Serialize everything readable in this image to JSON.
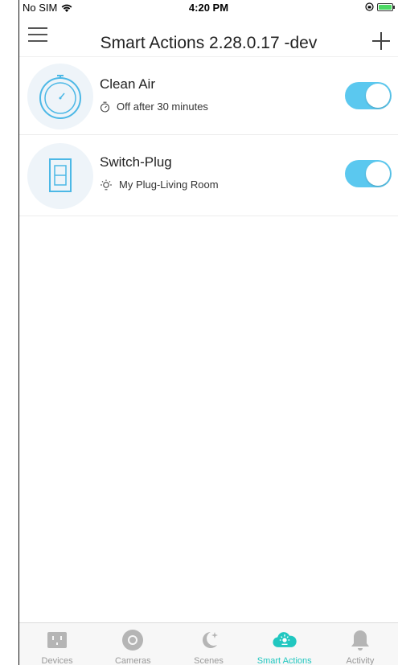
{
  "status_bar": {
    "carrier": "No SIM",
    "time": "4:20 PM"
  },
  "nav": {
    "title": "Smart Actions 2.28.0.17 -dev",
    "menu_icon": "hamburger-menu-icon",
    "add_icon": "plus-icon"
  },
  "actions": [
    {
      "title": "Clean Air",
      "subtitle": "Off after 30 minutes",
      "icon": "timer-icon",
      "sub_icon": "stopwatch-icon",
      "enabled": true
    },
    {
      "title": "Switch-Plug",
      "subtitle": "My Plug-Living Room",
      "icon": "light-switch-icon",
      "sub_icon": "bulb-icon",
      "enabled": true
    }
  ],
  "tabs": [
    {
      "label": "Devices",
      "icon": "outlet-icon",
      "active": false
    },
    {
      "label": "Cameras",
      "icon": "camera-icon",
      "active": false
    },
    {
      "label": "Scenes",
      "icon": "moon-icon",
      "active": false
    },
    {
      "label": "Smart Actions",
      "icon": "cloud-sparkle-icon",
      "active": true
    },
    {
      "label": "Activity",
      "icon": "bell-icon",
      "active": false
    }
  ],
  "colors": {
    "accent": "#21c7c0",
    "toggle_on": "#5bc8ef",
    "icon_blue": "#4cb8e6",
    "tab_inactive": "#999999"
  }
}
